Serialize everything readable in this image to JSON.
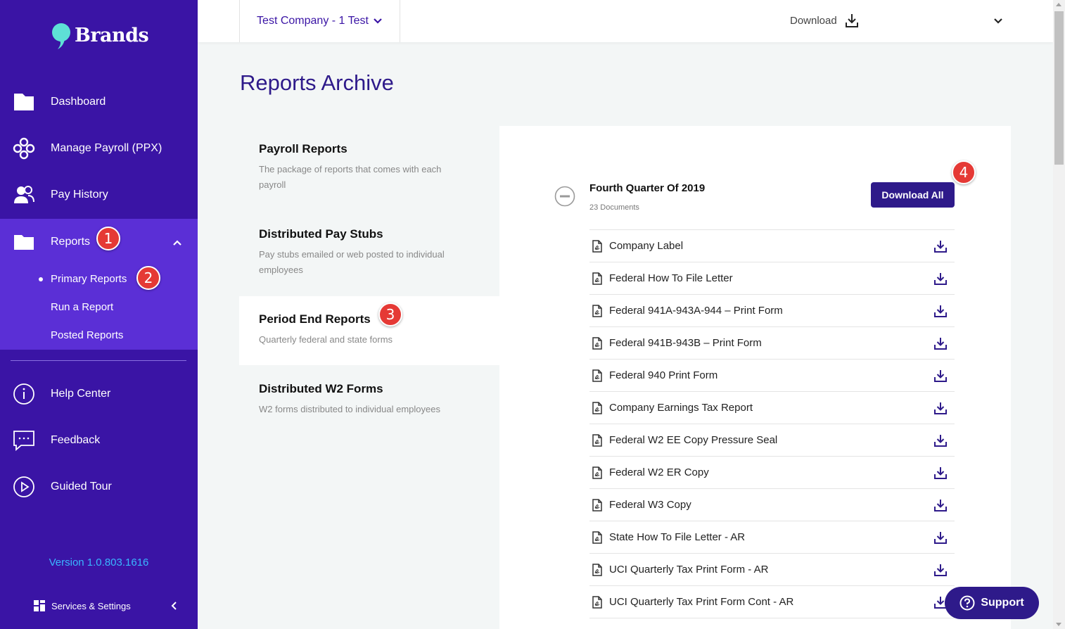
{
  "app": {
    "logo_text": "Brands"
  },
  "sidebar": {
    "items": [
      {
        "label": "Dashboard",
        "icon": "dashboard-icon"
      },
      {
        "label": "Manage Payroll (PPX)",
        "icon": "payroll-icon"
      },
      {
        "label": "Pay History",
        "icon": "pay-history-icon"
      },
      {
        "label": "Reports",
        "icon": "folder-icon",
        "badge": "1"
      }
    ],
    "sub_items": [
      {
        "label": "Primary Reports",
        "badge": "2"
      },
      {
        "label": "Run a Report"
      },
      {
        "label": "Posted Reports"
      }
    ],
    "bottom_items": [
      {
        "label": "Help Center",
        "icon": "info-icon"
      },
      {
        "label": "Feedback",
        "icon": "feedback-icon"
      },
      {
        "label": "Guided Tour",
        "icon": "play-icon"
      }
    ],
    "version": "Version 1.0.803.1616",
    "services_label": "Services & Settings"
  },
  "topbar": {
    "company": "Test Company - 1 Test",
    "download_label": "Download"
  },
  "main": {
    "title": "Reports Archive",
    "categories": [
      {
        "title": "Payroll Reports",
        "desc": "The package of reports that comes with each payroll"
      },
      {
        "title": "Distributed Pay Stubs",
        "desc": "Pay stubs emailed or web posted to individual employees"
      },
      {
        "title": "Period End Reports",
        "desc": "Quarterly federal and state forms",
        "badge": "3"
      },
      {
        "title": "Distributed W2 Forms",
        "desc": "W2 forms distributed to individual employees"
      }
    ],
    "quarter": {
      "title": "Fourth Quarter Of 2019",
      "count": "23 Documents",
      "download_all": "Download All",
      "badge": "4"
    },
    "documents": [
      "Company Label",
      "Federal How To File Letter",
      "Federal 941A-943A-944 – Print Form",
      "Federal 941B-943B – Print Form",
      "Federal 940 Print Form",
      "Company Earnings Tax Report",
      "Federal W2 EE Copy Pressure Seal",
      "Federal W2 ER Copy",
      "Federal W3 Copy",
      "State How To File Letter - AR",
      "UCI Quarterly Tax Print Form - AR",
      "UCI Quarterly Tax Print Form Cont - AR"
    ]
  },
  "support": {
    "label": "Support"
  },
  "colors": {
    "sidebar": "#3a14a5",
    "sidebar_active": "#5b2fd6",
    "accent": "#2e1a8a",
    "badge": "#e53935",
    "version": "#39b7ff"
  }
}
